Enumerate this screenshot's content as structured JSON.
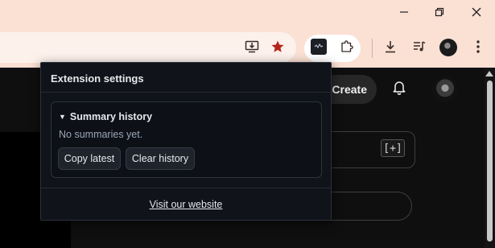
{
  "window": {
    "minimize_glyph": "—",
    "restore_glyph": "❐",
    "close_glyph": "✕"
  },
  "page": {
    "create_label": "Create",
    "plus_label": "[+]"
  },
  "popup": {
    "title": "Extension settings",
    "section": {
      "title": "Summary history",
      "toggle_glyph": "▼",
      "empty_text": "No summaries yet.",
      "copy_label": "Copy latest",
      "clear_label": "Clear history"
    },
    "link_label": "Visit our website"
  },
  "icons": [
    "install-icon",
    "star-icon",
    "extension-active-icon",
    "puzzle-icon",
    "download-icon",
    "media-icon",
    "profile-avatar",
    "menu-icon",
    "bell-icon"
  ],
  "colors": {
    "chrome_bg": "#fbe0d4",
    "star": "#b3261e",
    "popup_bg": "#101319",
    "page_bg": "#0f0f0f"
  }
}
